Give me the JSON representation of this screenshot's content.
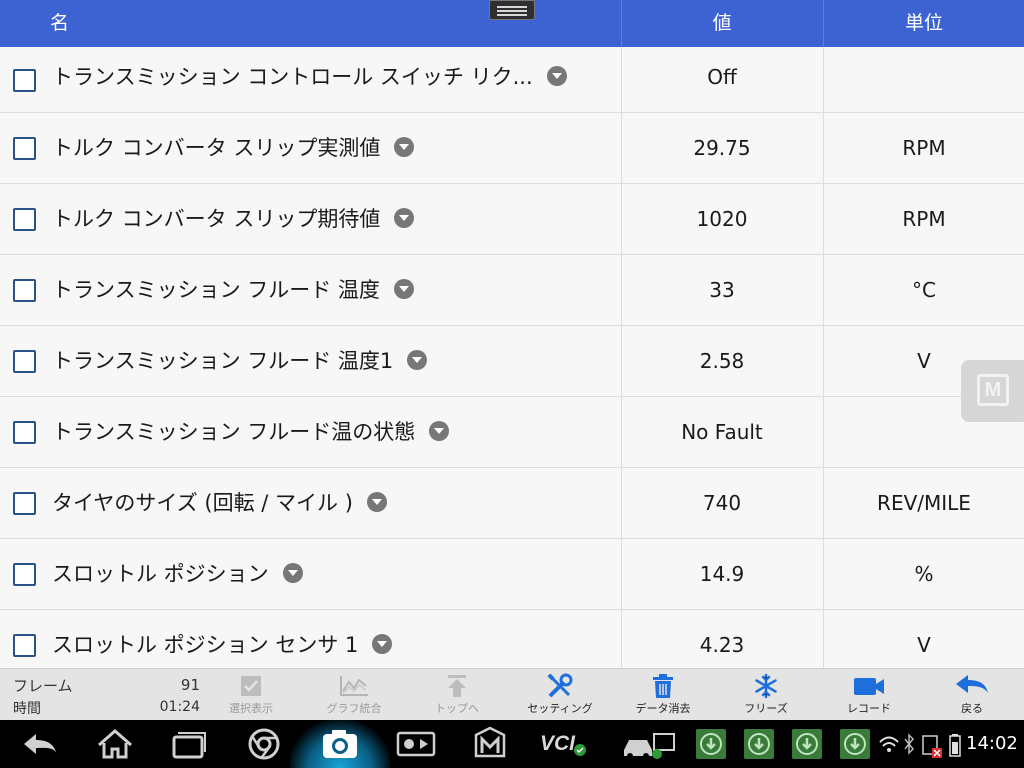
{
  "header": {
    "name": "名",
    "value": "値",
    "unit": "単位"
  },
  "rows": [
    {
      "label": "トランスミッション コントロール スイッチ リク...",
      "value": "Off",
      "unit": ""
    },
    {
      "label": "トルク コンバータ スリップ実測値",
      "value": "29.75",
      "unit": "RPM"
    },
    {
      "label": "トルク コンバータ スリップ期待値",
      "value": "1020",
      "unit": "RPM"
    },
    {
      "label": "トランスミッション フルード 温度",
      "value": "33",
      "unit": "°C"
    },
    {
      "label": "トランスミッション フルード 温度1",
      "value": "2.58",
      "unit": "V"
    },
    {
      "label": "トランスミッション フルード温の状態",
      "value": "No Fault",
      "unit": ""
    },
    {
      "label": "タイヤのサイズ (回転 / マイル )",
      "value": "740",
      "unit": "REV/MILE"
    },
    {
      "label": "スロットル ポジション",
      "value": "14.9",
      "unit": "%"
    },
    {
      "label": "スロットル ポジション センサ 1",
      "value": "4.23",
      "unit": "V"
    }
  ],
  "floating": {
    "letter": "M"
  },
  "toolbar": {
    "frame_label": "フレーム",
    "frame_value": "91",
    "time_label": "時間",
    "time_value": "01:24",
    "tools": [
      {
        "label": "選択表示",
        "icon": "check-box-icon",
        "enabled": false
      },
      {
        "label": "グラフ統合",
        "icon": "graph-icon",
        "enabled": false
      },
      {
        "label": "トップへ",
        "icon": "arrow-up-icon",
        "enabled": false
      },
      {
        "label": "セッティング",
        "icon": "wrench-icon",
        "enabled": true
      },
      {
        "label": "データ消去",
        "icon": "trash-icon",
        "enabled": true
      },
      {
        "label": "フリーズ",
        "icon": "snowflake-icon",
        "enabled": true
      },
      {
        "label": "レコード",
        "icon": "video-camera-icon",
        "enabled": true
      },
      {
        "label": "戻る",
        "icon": "back-arrow-icon",
        "enabled": true
      }
    ]
  },
  "navbar": {
    "vci_label": "VCI",
    "clock": "14:02"
  },
  "colors": {
    "header_bg": "#3d63d3",
    "accent": "#1e6fdc",
    "toolbar_bg": "#e4e4e4"
  }
}
